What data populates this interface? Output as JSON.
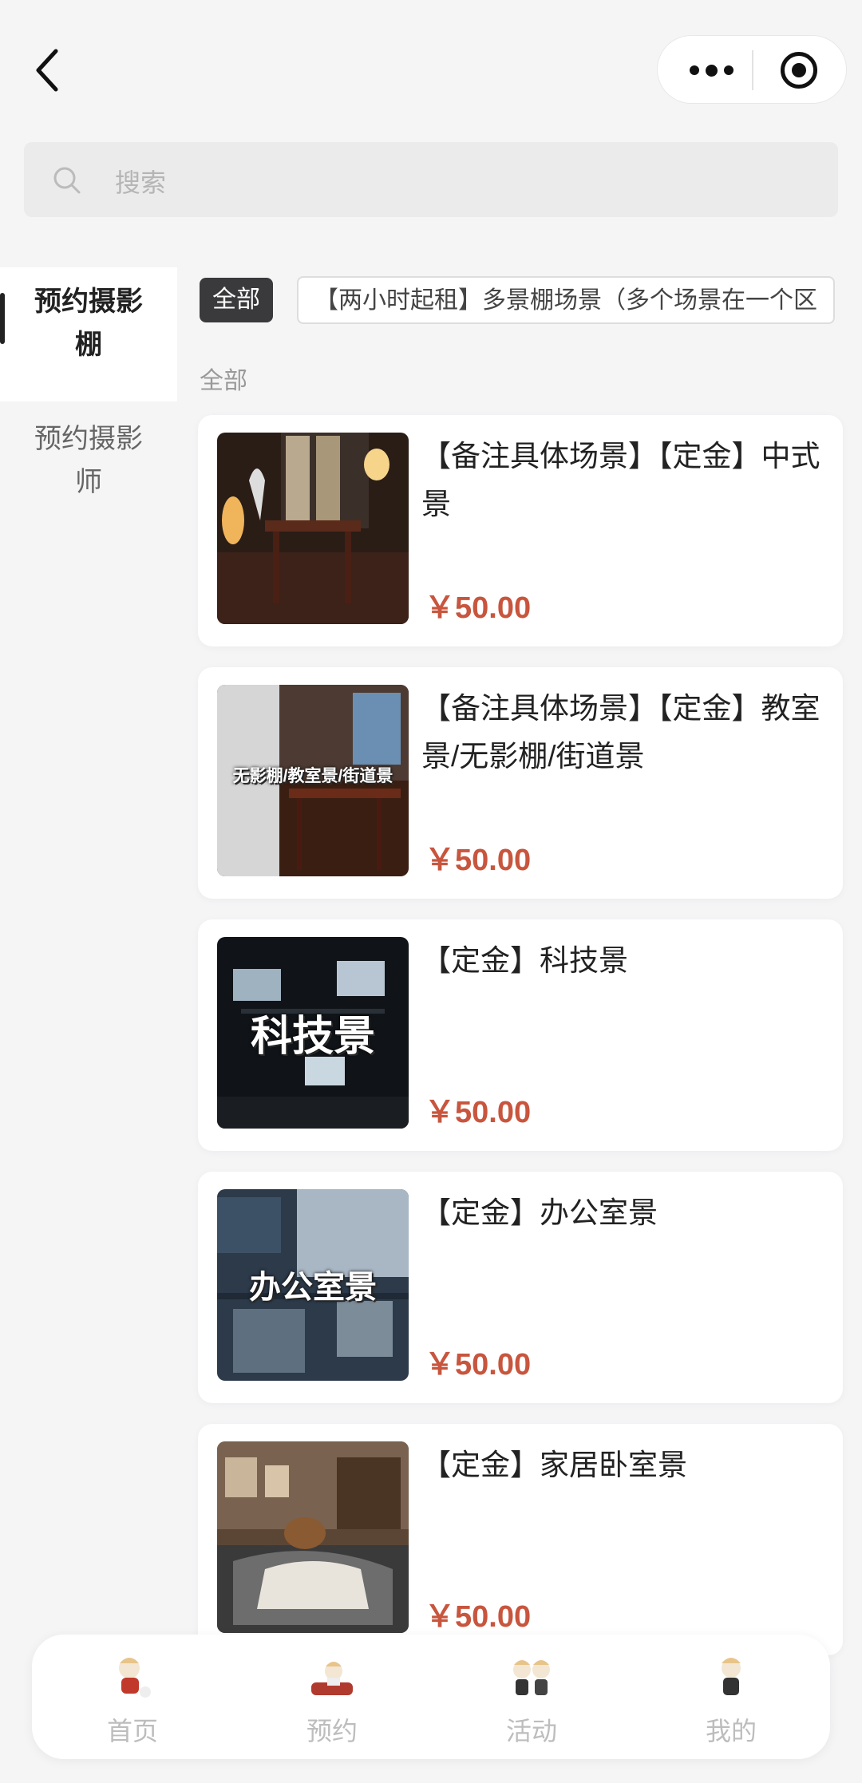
{
  "search": {
    "placeholder": "搜索"
  },
  "sidebar": {
    "items": [
      {
        "label": "预约摄影棚"
      },
      {
        "label": "预约摄影师"
      }
    ]
  },
  "filters": {
    "all_label": "全部",
    "chip_label": "【两小时起租】多景棚场景（多个场景在一个区"
  },
  "section": {
    "label": "全部"
  },
  "products": [
    {
      "title": "【备注具体场景】【定金】中式景",
      "price": "￥50.00"
    },
    {
      "title": "【备注具体场景】【定金】教室景/无影棚/街道景",
      "price": "￥50.00",
      "thumb_text": "无影棚/教室景/街道景"
    },
    {
      "title": "【定金】科技景",
      "price": "￥50.00",
      "thumb_text": "科技景"
    },
    {
      "title": "【定金】办公室景",
      "price": "￥50.00",
      "thumb_text": "办公室景"
    },
    {
      "title": "【定金】家居卧室景",
      "price": "￥50.00"
    }
  ],
  "tabbar": {
    "items": [
      {
        "label": "首页"
      },
      {
        "label": "预约"
      },
      {
        "label": "活动"
      },
      {
        "label": "我的"
      }
    ]
  },
  "colors": {
    "price": "#c8553d",
    "active_chip": "#3a3a3c",
    "tab_label": "#bdbdbd"
  }
}
